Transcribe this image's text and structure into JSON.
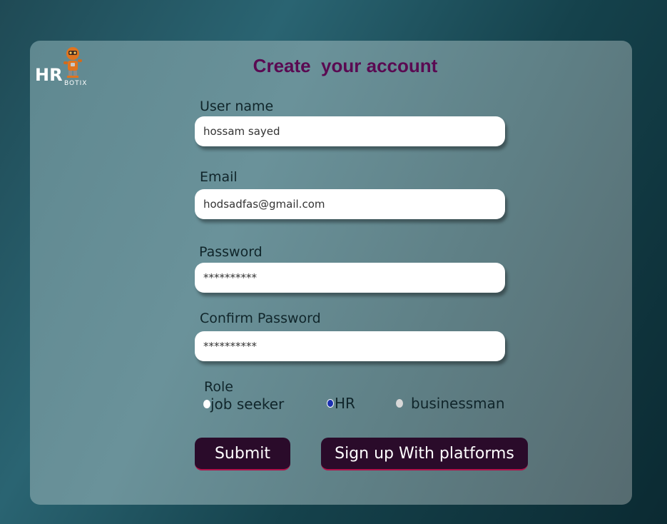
{
  "brand": {
    "logo_text": "HR",
    "logo_subtext": "BOTIX"
  },
  "form": {
    "title": "Create  your account",
    "username": {
      "label": "User name",
      "value": "hossam sayed"
    },
    "email": {
      "label": "Email",
      "value": "hodsadfas@gmail.com"
    },
    "password": {
      "label": "Password",
      "value": "**********"
    },
    "confirm_password": {
      "label": "Confirm Password",
      "value": "**********"
    },
    "role": {
      "label": "Role",
      "options": [
        "job seeker",
        "HR",
        "businessman"
      ],
      "selected": "HR"
    },
    "submit_label": "Submit",
    "platforms_label": "Sign up With platforms"
  },
  "colors": {
    "title": "#5a0a52",
    "button_bg": "#2a0b2a",
    "button_accent": "#b0124a",
    "radio_selected": "#1a2fb0"
  }
}
